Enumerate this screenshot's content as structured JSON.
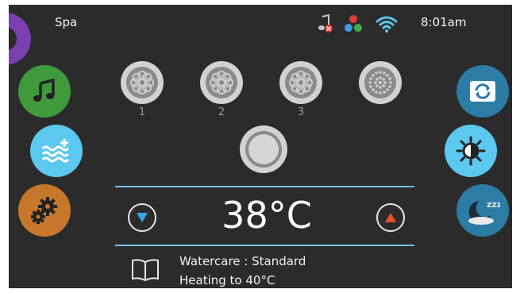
{
  "header": {
    "title": "Spa",
    "time": "8:01am",
    "status_icons": [
      "audio-disconnected-icon",
      "color-light-icon",
      "wifi-icon"
    ]
  },
  "left_menu": [
    {
      "name": "music-button",
      "icon": "music-note-icon",
      "color": "#3f9a3b"
    },
    {
      "name": "water-button",
      "icon": "water-add-icon",
      "color": "#5cc8f0"
    },
    {
      "name": "settings-button",
      "icon": "gears-icon",
      "color": "#c7772b"
    }
  ],
  "right_menu": [
    {
      "name": "invert-screen-button",
      "icon": "rotate-icon",
      "color": "#2c7ca6"
    },
    {
      "name": "light-button",
      "icon": "sun-icon",
      "color": "#5cc8f0"
    },
    {
      "name": "sleep-button",
      "icon": "moon-sleep-icon",
      "color": "#2c7ca6"
    }
  ],
  "jets": [
    {
      "label": "1"
    },
    {
      "label": "2"
    },
    {
      "label": "3"
    },
    {
      "label": ""
    }
  ],
  "temperature": {
    "value": "38°C"
  },
  "status": {
    "watercare": "Watercare : Standard",
    "heating": "Heating to 40°C"
  },
  "colors": {
    "background": "#2b2b2b",
    "accent_blue": "#6fc3e6",
    "arrow_down": "#3aa6e0",
    "arrow_up": "#e8502c"
  }
}
